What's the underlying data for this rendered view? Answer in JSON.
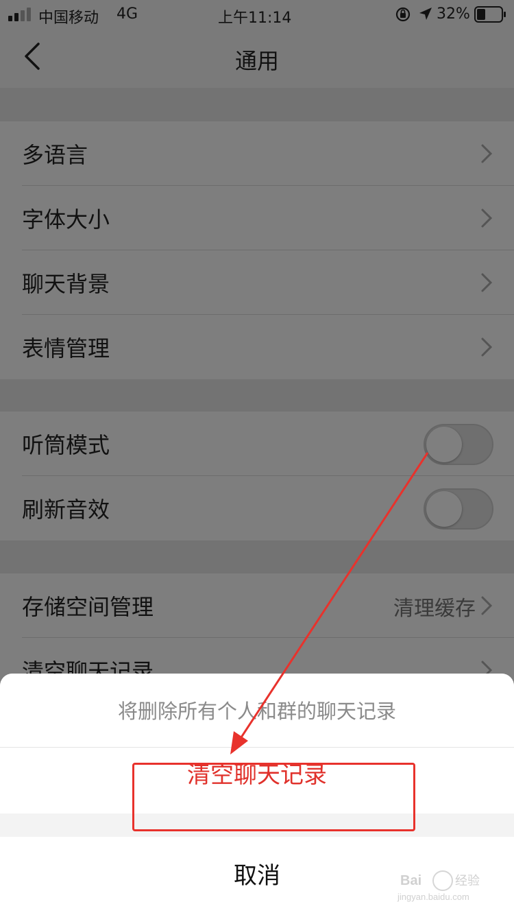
{
  "status_bar": {
    "carrier": "中国移动",
    "network": "4G",
    "time": "上午11:14",
    "battery": "32%"
  },
  "nav": {
    "title": "通用"
  },
  "groups": [
    {
      "items": [
        {
          "label": "多语言"
        },
        {
          "label": "字体大小"
        },
        {
          "label": "聊天背景"
        },
        {
          "label": "表情管理"
        }
      ]
    },
    {
      "items": [
        {
          "label": "听筒模式",
          "toggle_on": false
        },
        {
          "label": "刷新音效",
          "toggle_on": false
        }
      ]
    },
    {
      "items": [
        {
          "label": "存储空间管理",
          "value": "清理缓存"
        },
        {
          "label": "清空聊天记录"
        }
      ]
    }
  ],
  "action_sheet": {
    "message": "将删除所有个人和群的聊天记录",
    "confirm_label": "清空聊天记录",
    "cancel_label": "取消"
  },
  "colors": {
    "destructive": "#e0312b",
    "annotation": "#e8322c"
  },
  "watermark": {
    "brand": "Baidu经验",
    "url": "jingyan.baidu.com"
  }
}
